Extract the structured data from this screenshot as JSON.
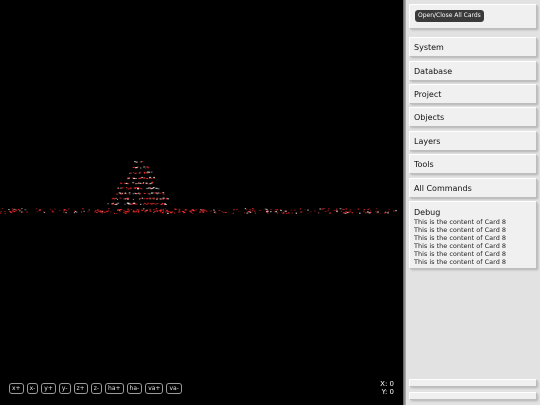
{
  "viewport": {
    "axis_buttons": [
      "x+",
      "x-",
      "y+",
      "y-",
      "z+",
      "z-",
      "ha+",
      "ha-",
      "va+",
      "va-"
    ],
    "coords": {
      "x_label": "X: 0",
      "y_label": "Y: 0"
    }
  },
  "panel": {
    "toggle_label": "Open/Close All Cards",
    "cards": [
      {
        "title": "System"
      },
      {
        "title": "Database"
      },
      {
        "title": "Project"
      },
      {
        "title": "Objects"
      },
      {
        "title": "Layers"
      },
      {
        "title": "Tools"
      },
      {
        "title": "All Commands"
      }
    ],
    "debug": {
      "title": "Debug",
      "lines": [
        "This is the content of Card 8",
        "This is the content of Card 8",
        "This is the content of Card 8",
        "This is the content of Card 8",
        "This is the content of Card 8",
        "This is the content of Card 8"
      ]
    }
  },
  "colors": {
    "viewport_bg": "#000000",
    "panel_bg": "#e2e2e2",
    "card_bg": "#f0f0f0",
    "point_red": "#ff2a2a",
    "point_white": "#f2f2f2"
  }
}
